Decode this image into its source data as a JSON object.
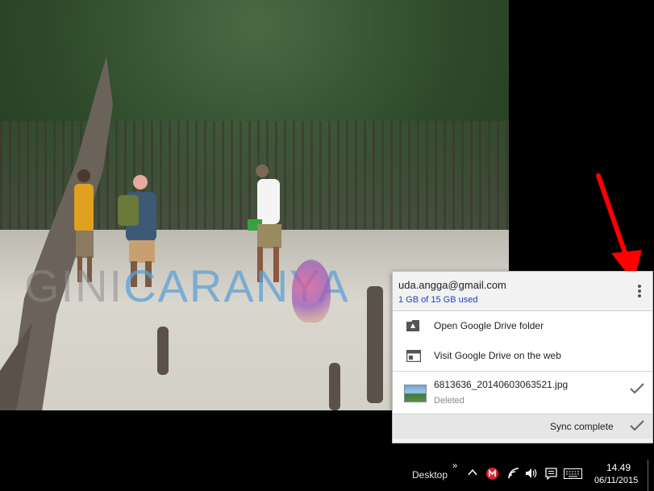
{
  "wallpaper": {
    "watermark_part1": "GINI",
    "watermark_part2": "CARANYA"
  },
  "drive_popup": {
    "account_email": "uda.angga@gmail.com",
    "storage_quota": "1 GB of 15 GB used",
    "menu": [
      {
        "label": "Open Google Drive folder",
        "icon": "drive-folder-icon"
      },
      {
        "label": "Visit Google Drive on the web",
        "icon": "browser-window-icon"
      }
    ],
    "recent_file": {
      "name": "6813636_20140603063521.jpg",
      "status": "Deleted"
    },
    "sync_status": "Sync complete"
  },
  "taskbar": {
    "desktop_label": "Desktop",
    "overflow_chevron": "»",
    "time": "14.49",
    "date": "06/11/2015"
  },
  "colors": {
    "annotation_arrow": "#ff0000",
    "quota_link": "#1a3fcf",
    "mega_badge": "#d9232d"
  }
}
